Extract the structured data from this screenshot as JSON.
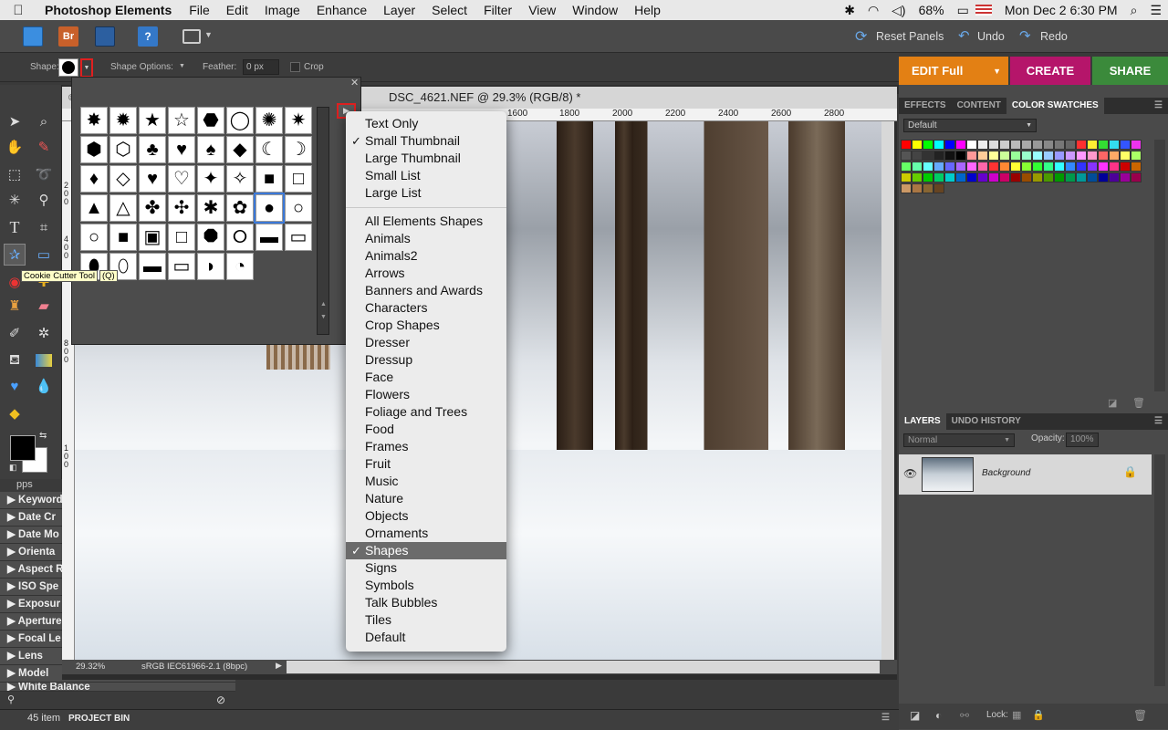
{
  "menubar": {
    "app_name": "Photoshop Elements",
    "items": [
      "File",
      "Edit",
      "Image",
      "Enhance",
      "Layer",
      "Select",
      "Filter",
      "View",
      "Window",
      "Help"
    ],
    "battery": "68%",
    "datetime": "Mon Dec 2  6:30 PM"
  },
  "appbar": {
    "reset_panels": "Reset Panels",
    "undo": "Undo",
    "redo": "Redo",
    "bridge_label": "Br",
    "help_label": "?"
  },
  "options": {
    "shape_label": "Shape:",
    "shape_options_label": "Shape Options:",
    "feather_label": "Feather:",
    "feather_value": "0 px",
    "crop_label": "Crop"
  },
  "modes": {
    "edit_full": "EDIT Full",
    "create": "CREATE",
    "share": "SHARE"
  },
  "tooltip": {
    "text": "Cookie Cutter Tool",
    "shortcut": "(Q)"
  },
  "document": {
    "title": "DSC_4621.NEF @ 29.3% (RGB/8) *",
    "ruler_top": [
      "1600",
      "1800",
      "2000",
      "2200",
      "2400",
      "2600",
      "2800"
    ],
    "ruler_left": [
      "2",
      "0",
      "0",
      "4",
      "0",
      "0",
      "8",
      "0",
      "0",
      "1",
      "0",
      "0"
    ],
    "zoom": "29.32%",
    "color_profile": "sRGB IEC61966-2.1 (8bpc)"
  },
  "shapes": {
    "rows": [
      [
        "✸",
        "✹",
        "★",
        "☆",
        "⬣",
        "◯",
        "✺",
        "✷"
      ],
      [
        "⬢",
        "⬡",
        "♣",
        "♥",
        "♠",
        "◆",
        "☾",
        "☽"
      ],
      [
        "♦",
        "◇",
        "♥",
        "♡",
        "✦",
        "✧",
        "■",
        "□"
      ],
      [
        "▲",
        "△",
        "✤",
        "✣",
        "✱",
        "✿",
        "●",
        "○"
      ],
      [
        "○",
        "■",
        "▣",
        "□",
        "⯃",
        "⭘",
        "▬",
        "▭"
      ],
      [
        "⬮",
        "⬯",
        "▬",
        "▭",
        "◗",
        "◔"
      ]
    ]
  },
  "shape_menu": {
    "view_items": [
      {
        "label": "Text Only",
        "checked": false
      },
      {
        "label": "Small Thumbnail",
        "checked": true
      },
      {
        "label": "Large Thumbnail",
        "checked": false
      },
      {
        "label": "Small List",
        "checked": false
      },
      {
        "label": "Large List",
        "checked": false
      }
    ],
    "library_items": [
      {
        "label": "All Elements Shapes",
        "checked": false
      },
      {
        "label": "Animals",
        "checked": false
      },
      {
        "label": "Animals2",
        "checked": false
      },
      {
        "label": "Arrows",
        "checked": false
      },
      {
        "label": "Banners and Awards",
        "checked": false
      },
      {
        "label": "Characters",
        "checked": false
      },
      {
        "label": "Crop Shapes",
        "checked": false
      },
      {
        "label": "Dresser",
        "checked": false
      },
      {
        "label": "Dressup",
        "checked": false
      },
      {
        "label": "Face",
        "checked": false
      },
      {
        "label": "Flowers",
        "checked": false
      },
      {
        "label": "Foliage and Trees",
        "checked": false
      },
      {
        "label": "Food",
        "checked": false
      },
      {
        "label": "Frames",
        "checked": false
      },
      {
        "label": "Fruit",
        "checked": false
      },
      {
        "label": "Music",
        "checked": false
      },
      {
        "label": "Nature",
        "checked": false
      },
      {
        "label": "Objects",
        "checked": false
      },
      {
        "label": "Ornaments",
        "checked": false
      },
      {
        "label": "Shapes",
        "checked": true
      },
      {
        "label": "Signs",
        "checked": false
      },
      {
        "label": "Symbols",
        "checked": false
      },
      {
        "label": "Talk Bubbles",
        "checked": false
      },
      {
        "label": "Tiles",
        "checked": false
      },
      {
        "label": "Default",
        "checked": false
      }
    ]
  },
  "panels": {
    "tabs_top": [
      "EFFECTS",
      "CONTENT",
      "COLOR SWATCHES"
    ],
    "swatch_set": "Default",
    "swatch_colors": [
      "#ff0000",
      "#ffff00",
      "#00ff00",
      "#00ffff",
      "#0000ff",
      "#ff00ff",
      "#ffffff",
      "#eeeeee",
      "#dddddd",
      "#cccccc",
      "#bbbbbb",
      "#aaaaaa",
      "#999999",
      "#888888",
      "#777777",
      "#666666",
      "#ff3030",
      "#ffee33",
      "#33dd33",
      "#33ddee",
      "#3355ff",
      "#ee33ee",
      "#555555",
      "#444444",
      "#333333",
      "#222222",
      "#111111",
      "#000000",
      "#ff9999",
      "#ffcc99",
      "#ffff99",
      "#ccff99",
      "#99ff99",
      "#99ffcc",
      "#99ffff",
      "#99ccff",
      "#9999ff",
      "#cc99ff",
      "#ff99ff",
      "#ff99cc",
      "#ff6666",
      "#ffaa66",
      "#ffff66",
      "#aaff66",
      "#66ff66",
      "#66ffaa",
      "#66ffff",
      "#66aaff",
      "#6666ff",
      "#aa66ff",
      "#ff66ff",
      "#ff66aa",
      "#ff3333",
      "#ff8833",
      "#ffff33",
      "#88ff33",
      "#33ff33",
      "#33ff88",
      "#33ffff",
      "#3388ff",
      "#3333ff",
      "#8833ff",
      "#ff33ff",
      "#ff3388",
      "#cc0000",
      "#cc6600",
      "#cccc00",
      "#66cc00",
      "#00cc00",
      "#00cc66",
      "#00cccc",
      "#0066cc",
      "#0000cc",
      "#6600cc",
      "#cc00cc",
      "#cc0066",
      "#990000",
      "#994c00",
      "#999900",
      "#4c9900",
      "#009900",
      "#00994c",
      "#009999",
      "#004c99",
      "#000099",
      "#4c0099",
      "#990099",
      "#99004c",
      "#cc9966",
      "#aa7744",
      "#886633",
      "#664422"
    ],
    "layers_tabs": [
      "LAYERS",
      "UNDO HISTORY"
    ],
    "blend_mode": "Normal",
    "opacity_label": "Opacity:",
    "opacity_value": "100%",
    "layer_name": "Background",
    "lock_label": "Lock:"
  },
  "keywords_panel": {
    "header_partial": "pps",
    "items": [
      "Keyword",
      "Date Cr",
      "Date Mo",
      "Orienta",
      "Aspect R",
      "ISO Spe",
      "Exposur",
      "Aperture",
      "Focal Le",
      "Lens",
      "Model",
      "White Balance"
    ],
    "count": "45 item"
  },
  "project_bin": {
    "label": "PROJECT BIN"
  }
}
